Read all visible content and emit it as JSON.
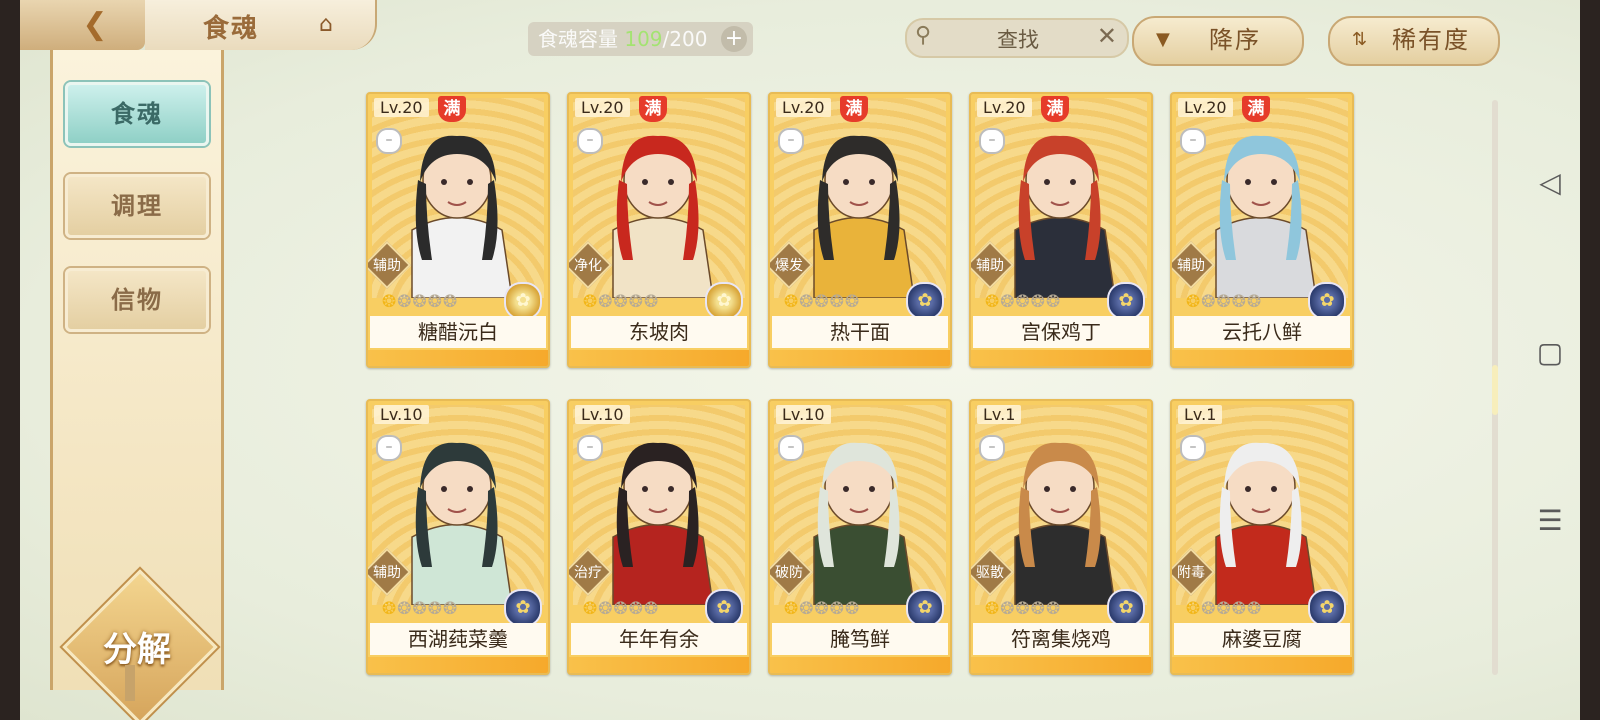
{
  "header": {
    "title": "食魂",
    "capacity_label": "食魂容量",
    "capacity_current": "109",
    "capacity_sep_max": "/200",
    "capacity_add": "+",
    "search_placeholder": "查找",
    "search_clear": "✕",
    "sort_order_label": "降序",
    "sort_by_label": "稀有度"
  },
  "sidebar": {
    "items": [
      {
        "label": "食魂",
        "active": true
      },
      {
        "label": "调理",
        "active": false
      },
      {
        "label": "信物",
        "active": false
      }
    ],
    "decompose_label": "分解"
  },
  "cards": [
    {
      "level": "Lv.20",
      "max": "满",
      "role": "辅助",
      "name": "糖醋沅白",
      "stars_lit": 1,
      "emblem": "gold",
      "hair": "#2b2b2b",
      "outfit": "#f2f2f2"
    },
    {
      "level": "Lv.20",
      "max": "满",
      "role": "净化",
      "name": "东坡肉",
      "stars_lit": 1,
      "emblem": "gold",
      "hair": "#c8281e",
      "outfit": "#f1e3c6"
    },
    {
      "level": "Lv.20",
      "max": "满",
      "role": "爆发",
      "name": "热干面",
      "stars_lit": 1,
      "emblem": "blue",
      "hair": "#2e2c2a",
      "outfit": "#e9b33a"
    },
    {
      "level": "Lv.20",
      "max": "满",
      "role": "辅助",
      "name": "宫保鸡丁",
      "stars_lit": 1,
      "emblem": "blue",
      "hair": "#c8412a",
      "outfit": "#2b2f3a"
    },
    {
      "level": "Lv.20",
      "max": "满",
      "role": "辅助",
      "name": "云托八鲜",
      "stars_lit": 1,
      "emblem": "blue",
      "hair": "#8fc6dc",
      "outfit": "#d9dadd"
    },
    {
      "level": "Lv.10",
      "max": "",
      "role": "辅助",
      "name": "西湖莼菜羹",
      "stars_lit": 1,
      "emblem": "blue",
      "hair": "#2d3a3a",
      "outfit": "#cfe6d6"
    },
    {
      "level": "Lv.10",
      "max": "",
      "role": "治疗",
      "name": "年年有余",
      "stars_lit": 1,
      "emblem": "blue",
      "hair": "#2a2222",
      "outfit": "#b5241f"
    },
    {
      "level": "Lv.10",
      "max": "",
      "role": "破防",
      "name": "腌笃鲜",
      "stars_lit": 1,
      "emblem": "blue",
      "hair": "#dfe5db",
      "outfit": "#3a4e32"
    },
    {
      "level": "Lv.1",
      "max": "",
      "role": "驱散",
      "name": "符离集烧鸡",
      "stars_lit": 1,
      "emblem": "blue",
      "hair": "#c98a4a",
      "outfit": "#2d2d2d"
    },
    {
      "level": "Lv.1",
      "max": "",
      "role": "附毒",
      "name": "麻婆豆腐",
      "stars_lit": 1,
      "emblem": "blue",
      "hair": "#eeeeee",
      "outfit": "#c22a1c"
    }
  ],
  "icons": {
    "back": "back-arrow-icon",
    "home": "home-icon",
    "search": "search-icon",
    "sort_order": "down-triangle-icon",
    "sort_by": "sort-icon",
    "lock": "lock-icon",
    "emblem": "rarity-emblem-icon",
    "nav_back": "◁",
    "nav_home": "▢",
    "nav_menu": "☰"
  },
  "colors": {
    "accent_gold": "#f8ce62",
    "max_badge": "#e63b2a",
    "active_tab": "#8fd0c6"
  }
}
